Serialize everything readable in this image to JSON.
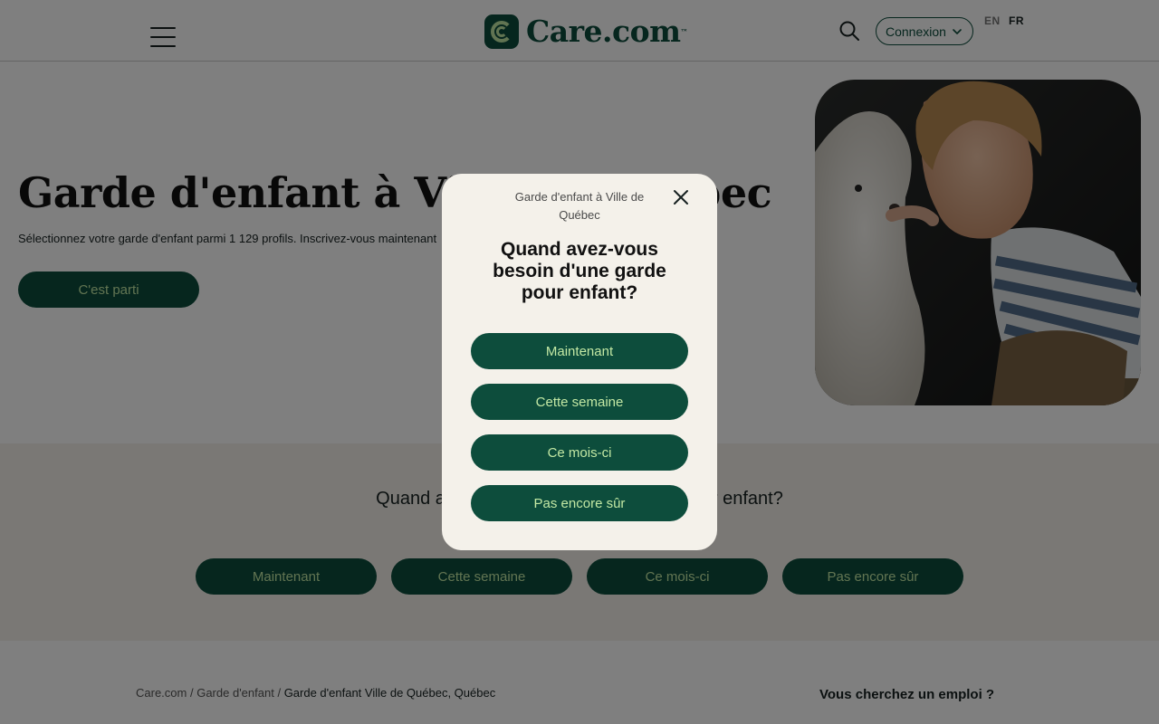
{
  "header": {
    "logo_text": "Care.com",
    "logo_tm": "™",
    "connexion_label": "Connexion",
    "lang_en": "EN",
    "lang_fr": "FR"
  },
  "hero": {
    "title": "Garde d'enfant à Ville de Québec",
    "subtitle": "Sélectionnez votre garde d'enfant parmi 1 129 profils. Inscrivez-vous maintenant",
    "cta_label": "C'est parti"
  },
  "band": {
    "question": "Quand avez-vous besoin d'une garde pour enfant?",
    "options": [
      "Maintenant",
      "Cette semaine",
      "Ce mois-ci",
      "Pas encore sûr"
    ]
  },
  "footer": {
    "breadcrumb_home": "Care.com",
    "breadcrumb_category": "Garde d'enfant",
    "breadcrumb_current": "Garde d'enfant Ville de Québec, Québec",
    "job_question": "Vous cherchez un emploi ?"
  },
  "modal": {
    "breadcrumb": "Garde d'enfant à Ville de Québec",
    "question": "Quand avez-vous besoin d'une garde pour enfant?",
    "options": [
      "Maintenant",
      "Cette semaine",
      "Ce mois-ci",
      "Pas encore sûr"
    ]
  },
  "icons": {
    "menu": "hamburger-icon",
    "search": "search-icon",
    "dropdown": "chevron-down-icon",
    "close": "close-icon"
  },
  "colors": {
    "brand_green": "#0d4d3c",
    "brand_lime": "#c3e8a4",
    "cream": "#f4f1ea"
  }
}
